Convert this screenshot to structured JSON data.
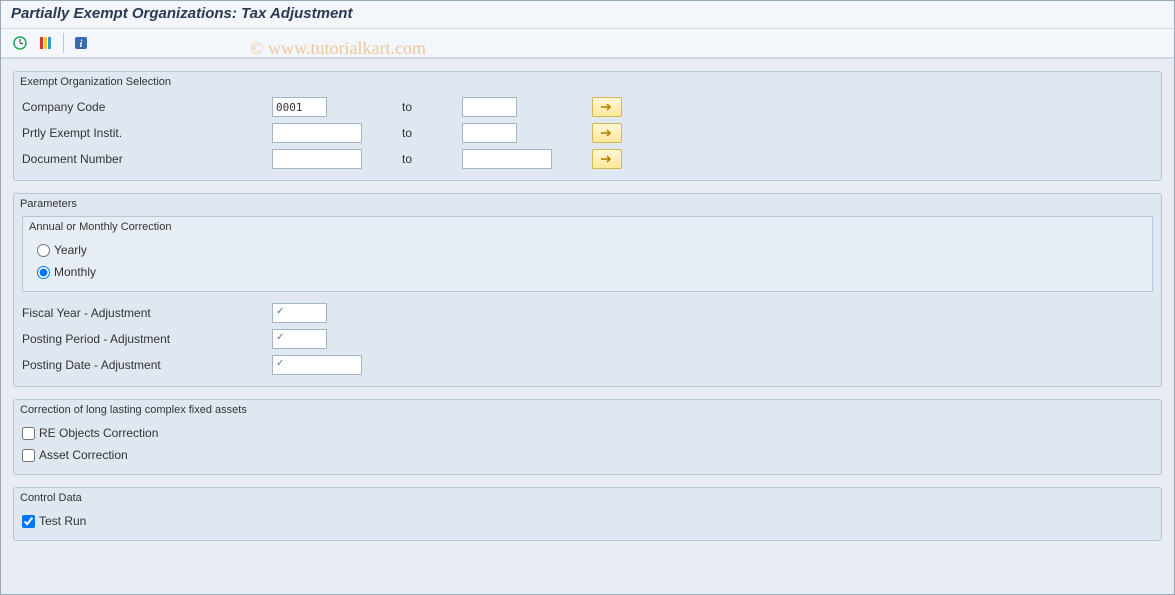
{
  "title": "Partially Exempt Organizations: Tax Adjustment",
  "watermark": "© www.tutorialkart.com",
  "toolbar": {
    "exec_icon": "execute-icon",
    "variant_icon": "variant-icon",
    "info_icon": "info-icon"
  },
  "groups": {
    "exempt_sel": {
      "title": "Exempt Organization Selection",
      "rows": [
        {
          "label": "Company Code",
          "from": "0001",
          "to_label": "to",
          "to": ""
        },
        {
          "label": "Prtly Exempt Instit.",
          "from": "",
          "to_label": "to",
          "to": ""
        },
        {
          "label": "Document Number",
          "from": "",
          "to_label": "to",
          "to": ""
        }
      ]
    },
    "parameters": {
      "title": "Parameters",
      "correction_group": {
        "title": "Annual or Monthly Correction",
        "options": [
          {
            "label": "Yearly",
            "selected": false
          },
          {
            "label": "Monthly",
            "selected": true
          }
        ]
      },
      "adjust_rows": [
        {
          "label": "Fiscal Year - Adjustment",
          "value": ""
        },
        {
          "label": "Posting Period - Adjustment",
          "value": ""
        },
        {
          "label": "Posting Date - Adjustment",
          "value": ""
        }
      ]
    },
    "correction_assets": {
      "title": "Correction of long lasting complex fixed assets",
      "checks": [
        {
          "label": "RE Objects Correction",
          "checked": false
        },
        {
          "label": "Asset Correction",
          "checked": false
        }
      ]
    },
    "control_data": {
      "title": "Control Data",
      "checks": [
        {
          "label": "Test Run",
          "checked": true
        }
      ]
    }
  }
}
